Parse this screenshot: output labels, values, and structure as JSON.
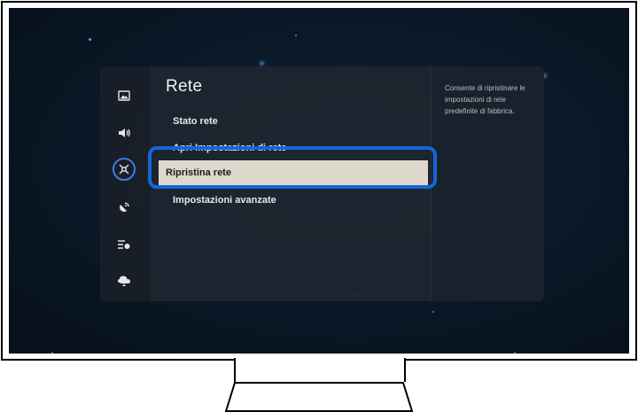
{
  "menu": {
    "title": "Rete",
    "items": [
      {
        "label": "Stato rete"
      },
      {
        "label": "Apri Impostazioni di rete"
      },
      {
        "label": "Ripristina rete",
        "focused": true
      },
      {
        "label": "Impostazioni avanzate"
      }
    ]
  },
  "sidebar": {
    "icons": [
      "picture-icon",
      "sound-icon",
      "network-icon",
      "broadcast-icon",
      "general-icon",
      "support-icon"
    ],
    "selected": "network-icon"
  },
  "description": "Consente di ripristinare le impostazioni di rete predefinite di fabbrica.",
  "colors": {
    "focus_ring": "#1466d8",
    "focused_item_bg": "#ded8cc",
    "panel_bg": "#1e2630"
  }
}
